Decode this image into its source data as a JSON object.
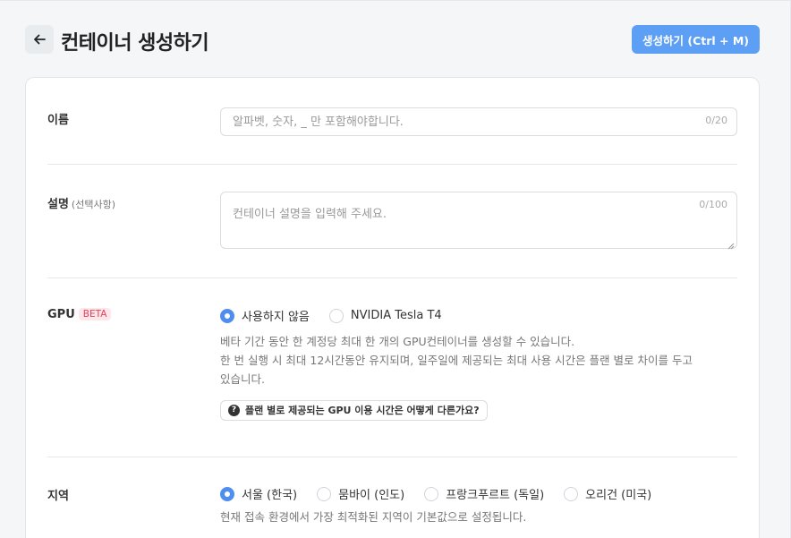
{
  "header": {
    "title": "컨테이너 생성하기",
    "create_label": "생성하기 (Ctrl + M)"
  },
  "form": {
    "name": {
      "label": "이름",
      "placeholder": "알파벳, 숫자, _ 만 포함해야합니다.",
      "value": "",
      "counter": "0/20"
    },
    "description": {
      "label": "설명",
      "label_sub": "(선택사항)",
      "placeholder": "컨테이너 설명을 입력해 주세요.",
      "value": "",
      "counter": "0/100"
    },
    "gpu": {
      "label": "GPU",
      "badge": "BETA",
      "options": [
        {
          "label": "사용하지 않음",
          "checked": true
        },
        {
          "label": "NVIDIA Tesla T4",
          "checked": false
        }
      ],
      "help_line1": "베타 기간 동안 한 계정당 최대 한 개의 GPU컨테이너를 생성할 수 있습니다.",
      "help_line2": "한 번 실행 시 최대 12시간동안 유지되며, 일주일에 제공되는 최대 사용 시간은 플랜 별로 차이를 두고",
      "help_line3": "있습니다.",
      "info_link": "플랜 별로 제공되는 GPU 이용 시간은 어떻게 다른가요?"
    },
    "region": {
      "label": "지역",
      "options": [
        {
          "label": "서울 (한국)",
          "checked": true
        },
        {
          "label": "뭄바이 (인도)",
          "checked": false
        },
        {
          "label": "프랑크푸르트 (독일)",
          "checked": false
        },
        {
          "label": "오리건 (미국)",
          "checked": false
        }
      ],
      "help": "현재 접속 환경에서 가장 최적화된 지역이 기본값으로 설정됩니다."
    }
  },
  "colors": {
    "accent": "#5c9ff4",
    "radio_checked": "#4f8ef0",
    "badge_bg": "#fde7ea",
    "badge_text": "#e0435c"
  },
  "icons": {
    "back": "arrow-left-icon",
    "help": "question-circle-icon"
  }
}
